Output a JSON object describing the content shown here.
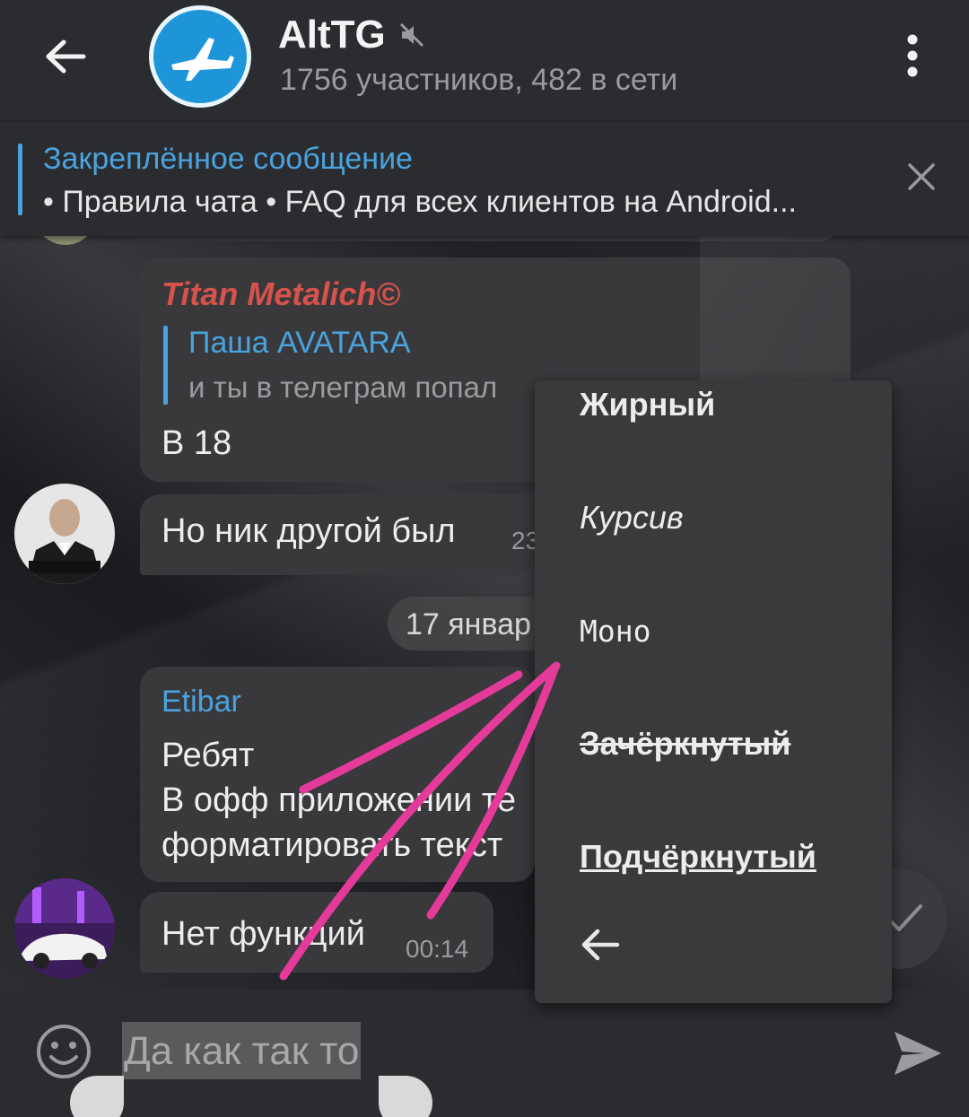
{
  "header": {
    "title": "AltTG",
    "subtitle": "1756 участников, 482 в сети",
    "icons": {
      "back": "arrow-left-icon",
      "muted": "muted-speaker-icon",
      "menu": "more-vertical-icon"
    }
  },
  "pinned": {
    "title": "Закреплённое сообщение",
    "text": "• Правила чата  • FAQ для всех клиентов на Android..."
  },
  "messages": [
    {
      "author": "Titan Metalich©",
      "reply_name": "Паша AVATARA",
      "reply_text": "и ты в телеграм попал",
      "text": "В 18"
    },
    {
      "text": "Но ник другой был",
      "time": "23"
    },
    {
      "author": "Etibar",
      "lines": [
        "Ребят",
        "В офф приложении те",
        "форматировать текст"
      ]
    },
    {
      "text": "Нет функций",
      "time": "00:14"
    }
  ],
  "date_separator": "17 январ",
  "format_menu": {
    "items": [
      "Жирный",
      "Курсив",
      "Моно",
      "Зачёркнутый",
      "Подчёркнутый"
    ],
    "back_icon": "arrow-left-icon"
  },
  "input": {
    "value": "Да как так то",
    "emoji_icon": "smiley-icon",
    "send_icon": "send-icon"
  },
  "colors": {
    "accent": "#4aa3de",
    "author_red": "#d7524b",
    "annotation_arrow": "#e43a9a"
  }
}
